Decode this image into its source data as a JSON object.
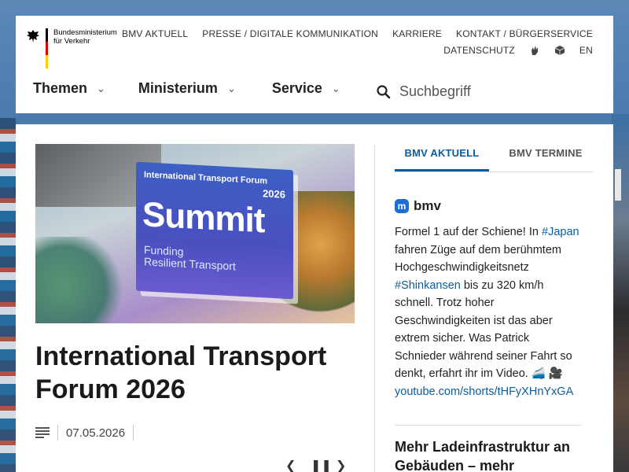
{
  "header": {
    "logo_text_line1": "Bundesministerium",
    "logo_text_line2": "für Verkehr",
    "meta_nav": [
      "BMV AKTUELL",
      "PRESSE / DIGITALE KOMMUNIKATION",
      "KARRIERE",
      "KONTAKT / BÜRGERSERVICE"
    ],
    "meta_nav_row2": {
      "privacy": "DATENSCHUTZ",
      "sign_language_icon": "sign-language-icon",
      "easy_language_icon": "easy-language-icon",
      "language": "EN"
    },
    "main_nav": [
      {
        "label": "Themen"
      },
      {
        "label": "Ministerium"
      },
      {
        "label": "Service"
      }
    ],
    "search_placeholder": "Suchbegriff"
  },
  "hero": {
    "sign_header": "International Transport Forum",
    "sign_year": "2026",
    "sign_main": "Summit",
    "sign_sub1": "Funding",
    "sign_sub2": "Resilient Transport"
  },
  "article": {
    "title": "International Transport Forum 2026",
    "date": "07.05.2026"
  },
  "sidebar": {
    "tabs": [
      {
        "label": "BMV AKTUELL",
        "active": true
      },
      {
        "label": "BMV TERMINE",
        "active": false
      }
    ],
    "social_handle": "bmv",
    "post": {
      "t1": "Formel 1 auf der Schiene! In ",
      "tag1": "#Japan",
      "t2": " fahren Züge auf dem berühmtem Hochgeschwindigkeitsnetz ",
      "tag2": "#Shinkansen",
      "t3": " bis zu 320 km/h schnell. Trotz hoher Geschwindigkeiten ist das aber extrem sicher. Was Patrick Schnieder während seiner Fahrt so denkt, erfahrt ihr im Video. 🚄 🎥",
      "link": "youtube.com/shorts/tHFyXHnYxGA"
    },
    "teaser_title": "Mehr Ladeinfrastruktur an Gebäuden – mehr"
  },
  "colors": {
    "accent": "#0b5c9e",
    "mastodon": "#1b6fd4"
  }
}
